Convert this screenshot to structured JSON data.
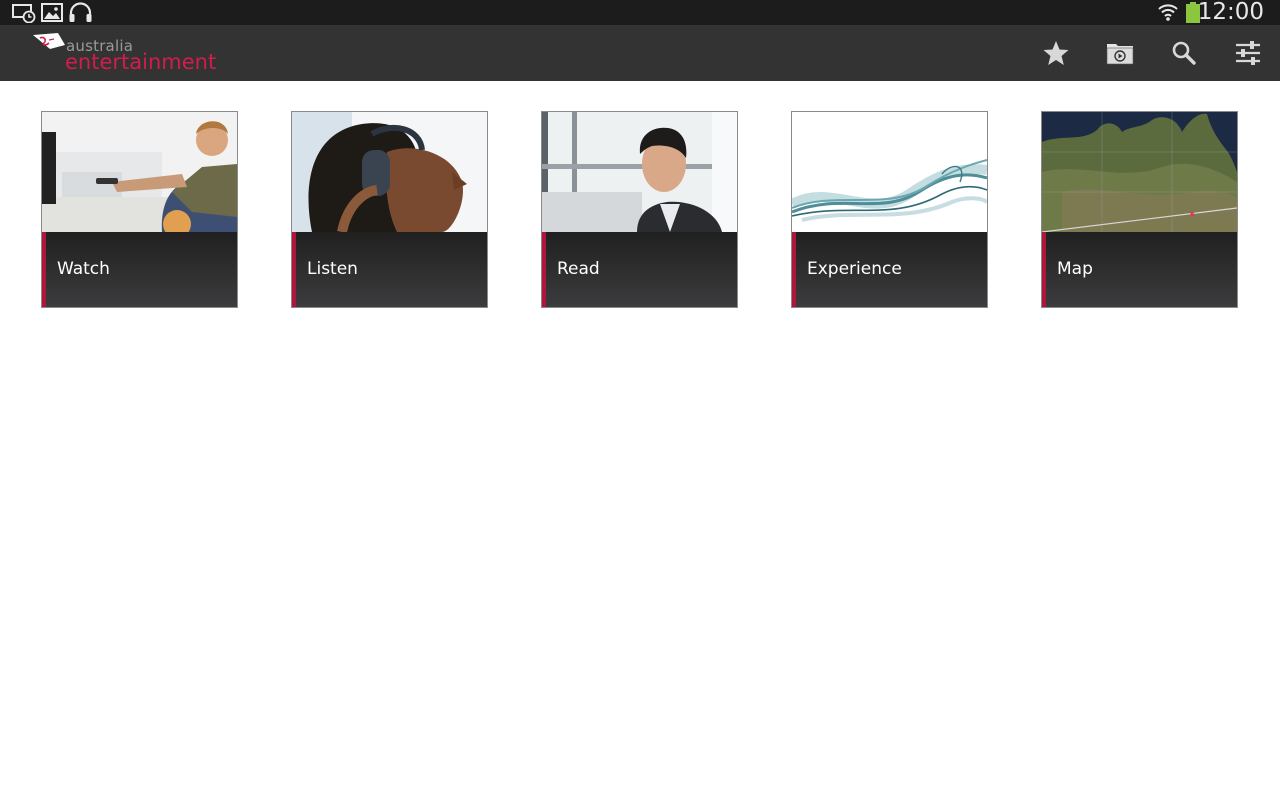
{
  "status_bar": {
    "time": "12:00",
    "icons": [
      "screen-timer-icon",
      "gallery-icon",
      "headphones-icon",
      "wifi-icon",
      "battery-icon"
    ],
    "battery_color": "#8cc63f"
  },
  "action_bar": {
    "brand_top": "australia",
    "brand_main": "entertainment",
    "brand_color": "#d11d4b",
    "actions": [
      "favorites-icon",
      "media-folder-icon",
      "search-icon",
      "settings-sliders-icon"
    ]
  },
  "tiles": [
    {
      "label": "Watch",
      "image": "man-with-remote-photo"
    },
    {
      "label": "Listen",
      "image": "woman-with-headphones-photo"
    },
    {
      "label": "Read",
      "image": "businessman-reading-photo"
    },
    {
      "label": "Experience",
      "image": "teal-smoke-wave-image"
    },
    {
      "label": "Map",
      "image": "australia-satellite-map"
    }
  ],
  "accent_color": "#b0153c"
}
